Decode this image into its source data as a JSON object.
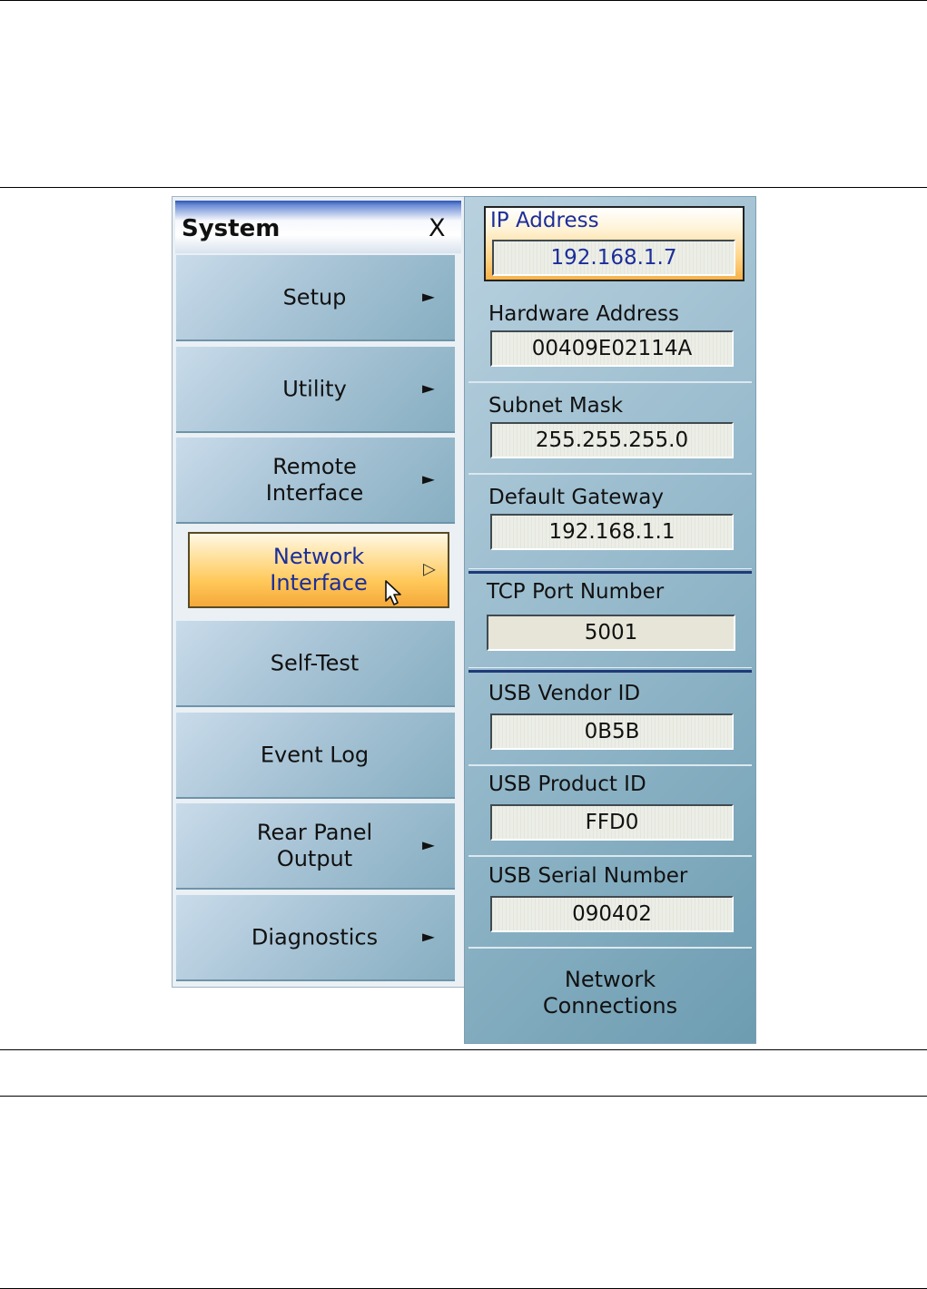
{
  "system_menu": {
    "title": "System",
    "close_label": "X",
    "items": [
      {
        "label": "Setup",
        "arrow": "►"
      },
      {
        "label": "Utility",
        "arrow": "►"
      },
      {
        "label": "Remote\nInterface",
        "arrow": "►"
      },
      {
        "label": "Network\nInterface",
        "arrow": "▷"
      },
      {
        "label": "Self-Test"
      },
      {
        "label": "Event Log"
      },
      {
        "label": "Rear Panel\nOutput",
        "arrow": "►"
      },
      {
        "label": "Diagnostics",
        "arrow": "►"
      }
    ],
    "active_item": "Network Interface"
  },
  "network_interface": {
    "ip_address": {
      "label": "IP Address",
      "value": "192.168.1.7"
    },
    "hardware_address": {
      "label": "Hardware Address",
      "value": "00409E02114A"
    },
    "subnet_mask": {
      "label": "Subnet Mask",
      "value": "255.255.255.0"
    },
    "default_gateway": {
      "label": "Default Gateway",
      "value": "192.168.1.1"
    },
    "tcp_port": {
      "label": "TCP Port Number",
      "value": "5001"
    },
    "usb_vendor_id": {
      "label": "USB Vendor ID",
      "value": "0B5B"
    },
    "usb_product_id": {
      "label": "USB Product ID",
      "value": "FFD0"
    },
    "usb_serial_number": {
      "label": "USB Serial Number",
      "value": "090402"
    },
    "network_connections_label": "Network\nConnections"
  },
  "colors": {
    "active_highlight": "#ffc95a",
    "active_text": "#1c2e9a",
    "panel_blue": "#95b9cb",
    "separator": "#1f3a78"
  },
  "icons": {
    "submenu_arrow": "triangle-right-icon",
    "cursor": "mouse-pointer-icon"
  }
}
